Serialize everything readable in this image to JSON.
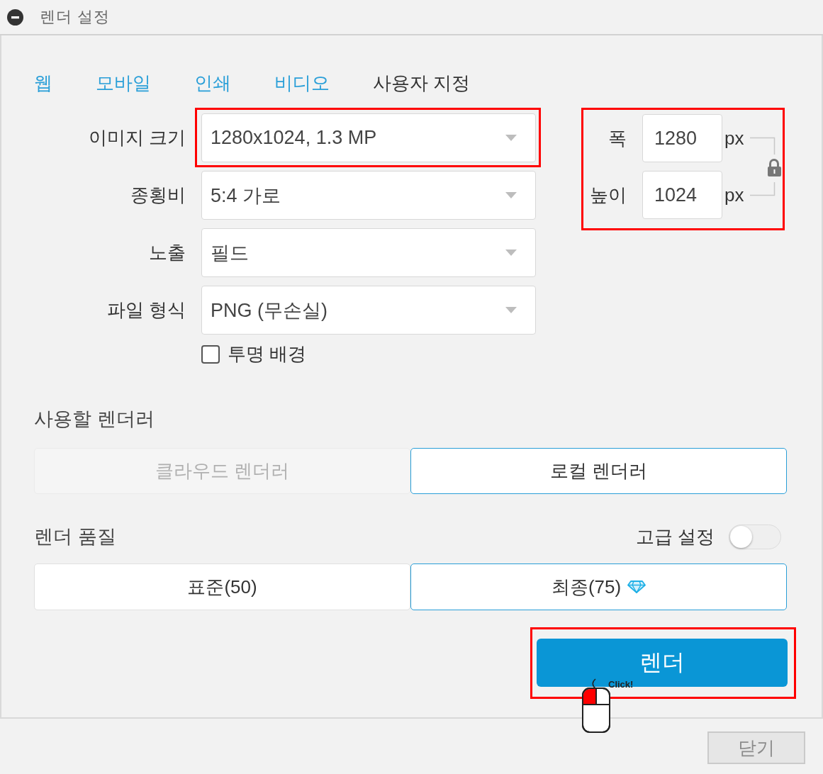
{
  "window": {
    "title": "렌더 설정"
  },
  "tabs": [
    {
      "label": "웹",
      "selected": false
    },
    {
      "label": "모바일",
      "selected": false
    },
    {
      "label": "인쇄",
      "selected": false
    },
    {
      "label": "비디오",
      "selected": false
    },
    {
      "label": "사용자 지정",
      "selected": true
    }
  ],
  "fields": [
    {
      "label": "이미지 크기",
      "value": "1280x1024, 1.3 MP",
      "highlighted": true
    },
    {
      "label": "종횡비",
      "value": "5:4 가로",
      "highlighted": false
    },
    {
      "label": "노출",
      "value": "필드",
      "highlighted": false
    },
    {
      "label": "파일 형식",
      "value": "PNG (무손실)",
      "highlighted": false
    }
  ],
  "transparent_background": {
    "label": "투명 배경",
    "checked": false
  },
  "dimensions": {
    "highlighted": true,
    "locked": true,
    "width": {
      "label": "폭",
      "value": "1280",
      "unit": "px"
    },
    "height": {
      "label": "높이",
      "value": "1024",
      "unit": "px"
    }
  },
  "renderer": {
    "title": "사용할 렌더러",
    "options": [
      {
        "label": "클라우드 렌더러",
        "selected": false,
        "disabled": true
      },
      {
        "label": "로컬 렌더러",
        "selected": true,
        "disabled": false
      }
    ]
  },
  "quality": {
    "title": "렌더 품질",
    "advanced": {
      "label": "고급 설정",
      "on": false
    },
    "options": [
      {
        "label": "표준(50)",
        "selected": false,
        "premium": false
      },
      {
        "label": "최종(75)",
        "selected": true,
        "premium": true
      }
    ]
  },
  "render_button": {
    "label": "렌더",
    "highlighted": true
  },
  "click_hint": {
    "label": "Click!"
  },
  "footer": {
    "close_button": "닫기"
  }
}
